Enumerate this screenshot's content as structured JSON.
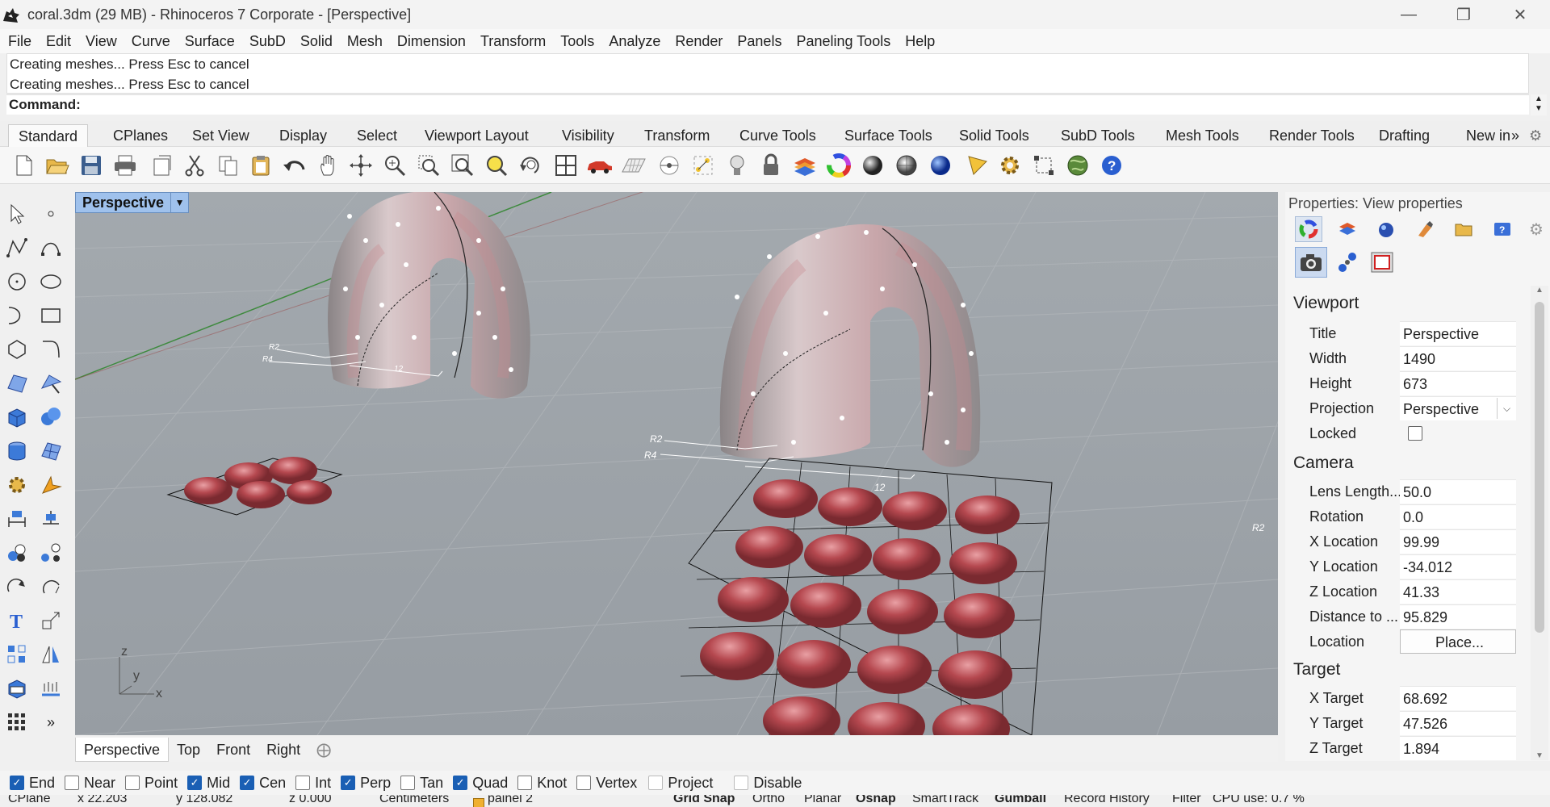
{
  "window": {
    "title": "coral.3dm (29 MB) - Rhinoceros 7 Corporate - [Perspective]",
    "controls": [
      "minimize",
      "restore",
      "close"
    ]
  },
  "menu": [
    "File",
    "Edit",
    "View",
    "Curve",
    "Surface",
    "SubD",
    "Solid",
    "Mesh",
    "Dimension",
    "Transform",
    "Tools",
    "Analyze",
    "Render",
    "Panels",
    "Paneling Tools",
    "Help"
  ],
  "command_history": [
    "Creating meshes... Press Esc to cancel",
    "Creating meshes... Press Esc to cancel"
  ],
  "command_prompt": "Command:",
  "toolbar_tabs": [
    "Standard",
    "CPlanes",
    "Set View",
    "Display",
    "Select",
    "Viewport Layout",
    "Visibility",
    "Transform",
    "Curve Tools",
    "Surface Tools",
    "Solid Tools",
    "SubD Tools",
    "Mesh Tools",
    "Render Tools",
    "Drafting",
    "New in"
  ],
  "active_tab": "Standard",
  "toolbar_icons": [
    "new-icon",
    "open-icon",
    "save-icon",
    "print-icon",
    "import-icon",
    "cut-icon",
    "copy-icon",
    "paste-icon",
    "undo-icon",
    "pan-icon",
    "rotate-view-icon",
    "zoom-dynamic-icon",
    "zoom-window-icon",
    "zoom-extents-icon",
    "zoom-selected-icon",
    "rotate-view-3d-icon",
    "four-viewports-icon",
    "car-icon",
    "grid-icon",
    "cplane-icon",
    "point-icon",
    "light-icon",
    "lock-icon",
    "layer-icon",
    "color-wheel-icon",
    "shaded-ball-icon",
    "rendered-ball-icon",
    "render-sphere-icon",
    "analysis-icon",
    "gear-icon",
    "dim-icon",
    "globe-icon",
    "help-icon"
  ],
  "viewport": {
    "name": "Perspective",
    "labels": {
      "r2_a": "R2",
      "r4_a": "R4",
      "dim_a": "12",
      "r2_b": "R2",
      "r4_b": "R4",
      "dim_b": "12",
      "r2_c": "R2"
    },
    "axes": {
      "z": "z",
      "y": "y",
      "x": "x"
    }
  },
  "viewport_tabs": [
    "Perspective",
    "Top",
    "Front",
    "Right"
  ],
  "active_viewport_tab": "Perspective",
  "properties": {
    "title": "Properties: View properties",
    "viewport_section": "Viewport",
    "viewport_fields": [
      {
        "label": "Title",
        "value": "Perspective"
      },
      {
        "label": "Width",
        "value": "1490"
      },
      {
        "label": "Height",
        "value": "673"
      },
      {
        "label": "Projection",
        "value": "Perspective"
      },
      {
        "label": "Locked",
        "value": ""
      }
    ],
    "camera_section": "Camera",
    "camera_fields": [
      {
        "label": "Lens Length...",
        "value": "50.0"
      },
      {
        "label": "Rotation",
        "value": "0.0"
      },
      {
        "label": "X Location",
        "value": "99.99"
      },
      {
        "label": "Y Location",
        "value": "-34.012"
      },
      {
        "label": "Z Location",
        "value": "41.33"
      },
      {
        "label": "Distance to ...",
        "value": "95.829"
      },
      {
        "label": "Location",
        "value": "Place..."
      }
    ],
    "target_section": "Target",
    "target_fields": [
      {
        "label": "X Target",
        "value": "68.692"
      },
      {
        "label": "Y Target",
        "value": "47.526"
      },
      {
        "label": "Z Target",
        "value": "1.894"
      }
    ]
  },
  "osnaps": [
    {
      "label": "End",
      "checked": true
    },
    {
      "label": "Near",
      "checked": false
    },
    {
      "label": "Point",
      "checked": false
    },
    {
      "label": "Mid",
      "checked": true
    },
    {
      "label": "Cen",
      "checked": true
    },
    {
      "label": "Int",
      "checked": false
    },
    {
      "label": "Perp",
      "checked": true
    },
    {
      "label": "Tan",
      "checked": false
    },
    {
      "label": "Quad",
      "checked": true
    },
    {
      "label": "Knot",
      "checked": false
    },
    {
      "label": "Vertex",
      "checked": false
    },
    {
      "label": "Project",
      "checked": false
    },
    {
      "label": "Disable",
      "checked": false
    }
  ],
  "status": {
    "cplane": "CPlane",
    "x": "x 22.203",
    "y": "y 128.082",
    "z": "z 0.000",
    "units": "Centimeters",
    "layer": "painel 2",
    "grid_snap": "Grid Snap",
    "ortho": "Ortho",
    "planar": "Planar",
    "osnap": "Osnap",
    "smarttrack": "SmartTrack",
    "gumball": "Gumball",
    "record_history": "Record History",
    "filter": "Filter",
    "cpu": "CPU use: 0.7 %"
  },
  "colors": {
    "viewport_bg": "#9ea4aa",
    "viewport_tab": "#9fc1ec",
    "checkbox_on": "#1a5fb4",
    "coral": "#b5484f"
  }
}
